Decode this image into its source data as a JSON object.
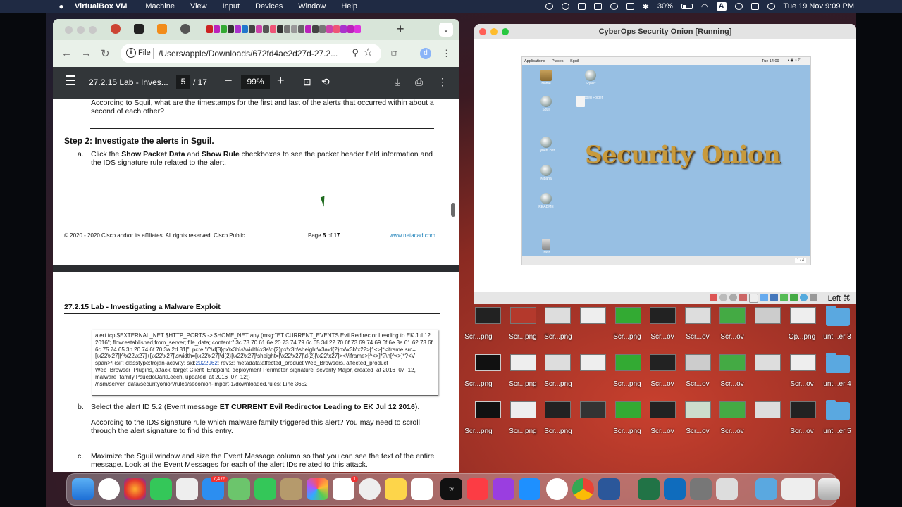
{
  "menubar": {
    "apple": "",
    "app_name": "VirtualBox VM",
    "menus": [
      "Machine",
      "View",
      "Input",
      "Devices",
      "Window",
      "Help"
    ],
    "battery": "30%",
    "input_source": "A",
    "datetime": "Tue 19 Nov  9:09 PM"
  },
  "chrome": {
    "new_tab": "+",
    "tab_dropdown": "⌄",
    "omnibox_scheme": "File",
    "url": "/Users/apple/Downloads/672fd4ae2d27d-27.2...",
    "profile_initial": "d"
  },
  "pdf": {
    "title": "27.2.15 Lab - Inves...",
    "page_current": "5",
    "page_total": "/ 17",
    "zoom": "99%"
  },
  "doc": {
    "question_sguil": "According to Sguil, what are the timestamps for the first and last of the alerts that occurred within about a second of each other?",
    "step2_heading": "Step 2: Investigate the alerts in Sguil.",
    "item_a_marker": "a.",
    "item_a_pre": "Click the ",
    "item_a_b1": "Show Packet Data",
    "item_a_mid": " and ",
    "item_a_b2": "Show Rule",
    "item_a_post": " checkboxes to see the packet header field information and the IDS signature rule related to the alert.",
    "footer_copyright": "© 2020 - 2020 Cisco and/or its affiliates. All rights reserved. Cisco Public",
    "footer_page_pre": "Page ",
    "footer_page_num": "5",
    "footer_page_of": " of ",
    "footer_page_total": "17",
    "footer_link": "www.netacad.com",
    "page_header": "27.2.15 Lab - Investigating a Malware Exploit",
    "rule_text_pre": "alert tcp $EXTERNAL_NET $HTTP_PORTS -> $HOME_NET any (msg:\"ET CURRENT_EVENTS Evil Redirector Leading to EK Jul 12 2016\"; flow:established,from_server; file_data; content:\"|3c 73 70 61 6e 20 73 74 79 6c 65 3d 22 70 6f 73 69 74 69 6f 6e 3a 61 62 73 6f 6c 75 74 65 3b 20 74 6f 70 3a 2d 31|\"; pcre:\"/^\\d{3}px\\x3b\\s\\width\\x3a\\d{2}px\\x3b\\sheight\\x3a\\d{2}px\\x3b\\x22>[^<>]*<iframe src=[\\x22\\x27][^\\x22\\x27]+[\\x22\\x27]\\swidth=[\\x22\\x27]\\d{2}[\\x22\\x27]\\sheight=[\\x22\\x27]\\d{2}[\\x22\\x27]><\\/iframe>[^<>]*?\\n[^<>]*?<V span>/Rsi\"; classtype:trojan-activity; sid:",
    "rule_sid": "2022962",
    "rule_text_post": "; rev:3; metadata:affected_product Web_Browsers, affected_product Web_Browser_Plugins, attack_target Client_Endpoint, deployment Perimeter, signature_severity Major, created_at 2016_07_12, malware_family PsuedoDarkLeech, updated_at 2016_07_12;)",
    "rule_path": "/nsm/server_data/securityonion/rules/seconion-import-1/downloaded.rules: Line 3652",
    "item_b_marker": "b.",
    "item_b_pre": "Select the alert ID 5.2 (Event message ",
    "item_b_bold": "ET CURRENT Evil Redirector Leading to EK Jul 12 2016",
    "item_b_post": ").",
    "item_b_question": "According to the IDS signature rule which malware family triggered this alert? You may need to scroll through the alert signature to find this entry.",
    "item_c_marker": "c.",
    "item_c_text": "Maximize the Sguil window and size the Event Message column so that you can see the text of the entire message. Look at the Event Messages for each of the alert IDs related to this attack."
  },
  "vbox": {
    "title": "CyberOps Security Onion [Running]",
    "vm_menu": [
      "Applications",
      "Places",
      "Sguil"
    ],
    "vm_clock": "Tue 14:09",
    "desktop_icons": [
      {
        "label": "Home"
      },
      {
        "label": "Sguil"
      },
      {
        "label": "CyberChef"
      },
      {
        "label": "Kibana"
      },
      {
        "label": "README"
      },
      {
        "label": "Trash"
      },
      {
        "label": "Squert"
      },
      {
        "label": "Dropped Folder"
      }
    ],
    "logo_text": "Security Onion",
    "pager": "1 / 4",
    "host_key": "Left ⌘"
  },
  "desktop": {
    "row1_labels": [
      "Scr...png",
      "Scr...png",
      "Scr...png",
      "Scr...png",
      "Scr...ov",
      "Scr...ov",
      "Scr...ov",
      "Op...png",
      "unt...er 3"
    ],
    "row2_labels": [
      "Scr...png",
      "Scr...png",
      "Scr...png",
      "Scr...png",
      "Scr...ov",
      "Scr...ov",
      "Scr...ov",
      "Scr...ov",
      "unt...er 4"
    ],
    "row3_labels": [
      "Scr...png",
      "Scr...png",
      "Scr...png",
      "Scr...png",
      "Scr...ov",
      "Scr...ov",
      "Scr...ov",
      "Scr...ov",
      "unt...er 5"
    ]
  },
  "dock": {
    "tv_label": "tv",
    "mail_badge": "7,476",
    "reminders_badge": "1"
  }
}
